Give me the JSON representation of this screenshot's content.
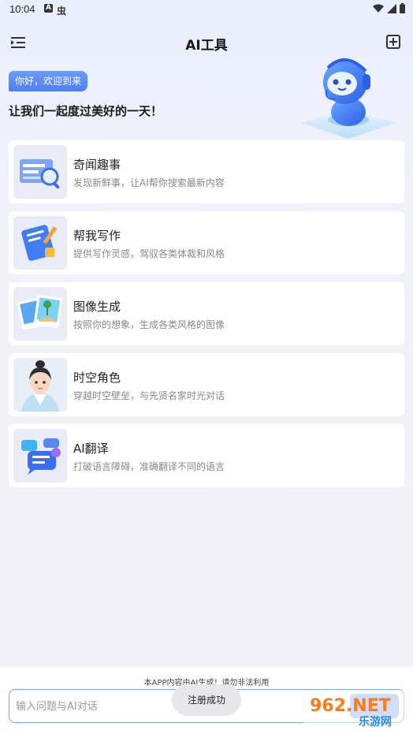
{
  "status": {
    "time": "10:04",
    "a_icon": "A",
    "bug_icon": "虫"
  },
  "header": {
    "title": "AI工具",
    "menu_icon": "menu-indent-icon",
    "add_icon": "plus-square-icon"
  },
  "greeting": "你好，欢迎到来",
  "tagline": "让我们一起度过美好的一天！",
  "cards": [
    {
      "title": "奇闻趣事",
      "desc": "发现新鲜事，让AI帮你搜索最新内容",
      "icon": "news-search-icon"
    },
    {
      "title": "帮我写作",
      "desc": "提供写作灵感，驾驭各类体裁和风格",
      "icon": "writing-book-icon"
    },
    {
      "title": "图像生成",
      "desc": "按照你的想象，生成各类风格的图像",
      "icon": "image-photos-icon"
    },
    {
      "title": "时空角色",
      "desc": "穿越时空壁垒，与先贤名家时光对话",
      "icon": "ancient-character-avatar"
    },
    {
      "title": "AI翻译",
      "desc": "打破语言障碍，准确翻译不同的语言",
      "icon": "chat-bubbles-icon"
    }
  ],
  "footer": {
    "disclaimer": "本APP内容由AI生成！请勿非法利用",
    "input_placeholder": "输入问题与AI对话",
    "toast": "注册成功",
    "watermark_top": "962.NET",
    "watermark_bottom": "乐游网"
  },
  "colors": {
    "accent": "#4e7ff0",
    "background": "#f2f2f6"
  }
}
